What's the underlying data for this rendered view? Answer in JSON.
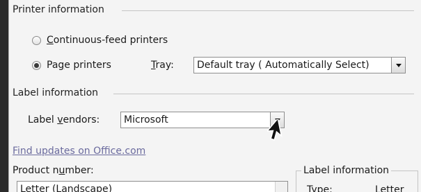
{
  "printer_info": {
    "heading": "Printer information",
    "continuous_feed": {
      "label": "Continuous-feed printers",
      "underline_char": "C",
      "rest": "ontinuous-feed printers",
      "selected": false
    },
    "page_printers": {
      "label": "Page printers",
      "pre": "Pa",
      "underline_char": "g",
      "rest": "e printers",
      "selected": true
    },
    "tray": {
      "label_pre": "",
      "underline_char": "T",
      "label_rest": "ray:",
      "value": "Default tray ( Automatically Select)"
    }
  },
  "label_info": {
    "heading": "Label information",
    "vendors": {
      "label_pre": "Label ",
      "underline_char": "v",
      "label_rest": "endors:",
      "value": "Microsoft"
    },
    "find_updates_link": "Find updates on Office.com"
  },
  "product": {
    "label_pre": "Product n",
    "underline_char": "u",
    "label_rest": "mber:",
    "selected_item": "Letter (Landscape)"
  },
  "details_group": {
    "heading": "Label information",
    "type_label": "Type:",
    "type_value": "Letter"
  }
}
